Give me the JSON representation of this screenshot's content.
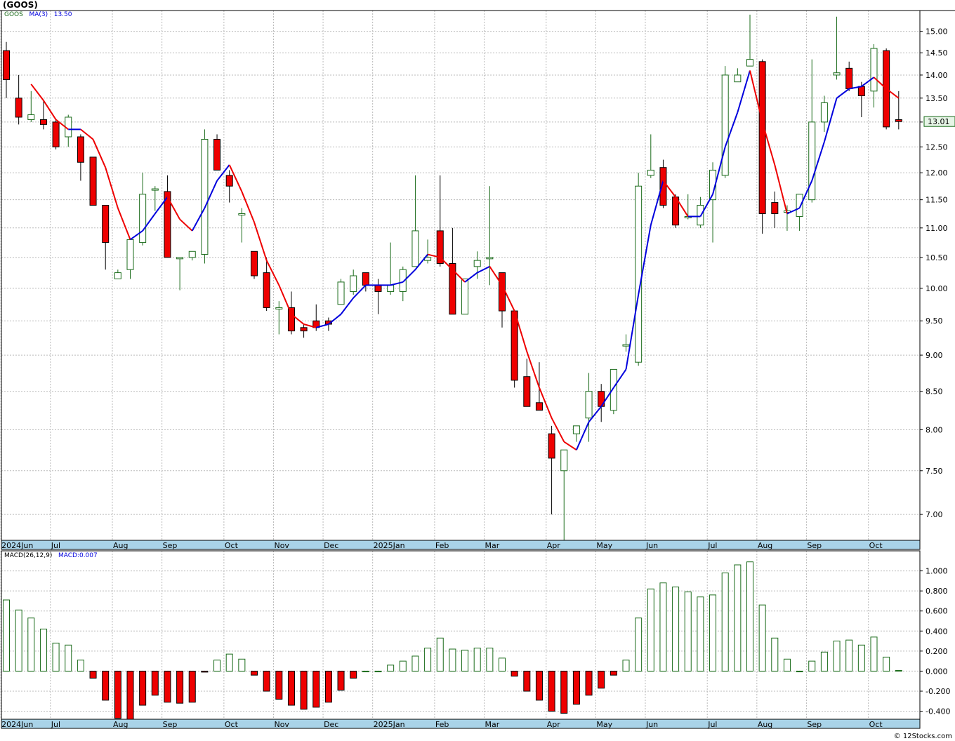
{
  "header": {
    "ticker": "(GOOS)"
  },
  "price_legend": {
    "symbol": "GOOS",
    "ma_label": "MA(3)",
    "ma_value": "13.50"
  },
  "macd_legend": {
    "label": "MACD(26,12,9)",
    "value_label": "MACD:0.007"
  },
  "last_price_tag": "13.01",
  "watermark": "© 12Stocks.com",
  "colors": {
    "up": "#1a6b1a",
    "down": "#ee0000",
    "ma_up": "#0000dd",
    "ma_down": "#ee0000",
    "grid": "#bbbbbb",
    "axis_band": "#a9d3e8"
  },
  "chart_data": [
    {
      "type": "candlestick",
      "title": "(GOOS)",
      "interval": "weekly",
      "y_scale": "log",
      "ylim": [
        6.72,
        15.5
      ],
      "y_ticks": [
        "7.00",
        "7.50",
        "8.00",
        "8.50",
        "9.00",
        "9.50",
        "10.00",
        "10.50",
        "11.00",
        "11.50",
        "12.00",
        "12.50",
        "13.00",
        "13.50",
        "14.00",
        "14.50",
        "15.00"
      ],
      "x_tick_labels": [
        {
          "label": "2024Jun",
          "week": 0
        },
        {
          "label": "Jul",
          "week": 4
        },
        {
          "label": "Aug",
          "week": 9
        },
        {
          "label": "Sep",
          "week": 13
        },
        {
          "label": "Oct",
          "week": 18
        },
        {
          "label": "Nov",
          "week": 22
        },
        {
          "label": "Dec",
          "week": 26
        },
        {
          "label": "2025Jan",
          "week": 30
        },
        {
          "label": "Feb",
          "week": 35
        },
        {
          "label": "Mar",
          "week": 39
        },
        {
          "label": "Apr",
          "week": 44
        },
        {
          "label": "May",
          "week": 48
        },
        {
          "label": "Jun",
          "week": 52
        },
        {
          "label": "Jul",
          "week": 57
        },
        {
          "label": "Aug",
          "week": 61
        },
        {
          "label": "Sep",
          "week": 65
        },
        {
          "label": "Oct",
          "week": 70
        }
      ],
      "grid": true,
      "ohlc": [
        [
          14.55,
          14.75,
          13.5,
          13.9
        ],
        [
          13.5,
          14.0,
          12.95,
          13.1
        ],
        [
          13.05,
          13.65,
          13.0,
          13.15
        ],
        [
          13.05,
          13.45,
          12.85,
          12.95
        ],
        [
          13.0,
          13.05,
          12.45,
          12.5
        ],
        [
          12.7,
          13.15,
          12.5,
          13.1
        ],
        [
          12.7,
          12.75,
          11.85,
          12.2
        ],
        [
          12.3,
          12.3,
          11.4,
          11.4
        ],
        [
          11.4,
          11.4,
          10.3,
          10.75
        ],
        [
          10.15,
          10.3,
          10.15,
          10.25
        ],
        [
          10.3,
          10.8,
          10.15,
          10.8
        ],
        [
          10.75,
          12.0,
          10.7,
          11.6
        ],
        [
          11.7,
          11.75,
          11.3,
          11.7
        ],
        [
          11.65,
          11.95,
          10.5,
          10.5
        ],
        [
          10.5,
          10.5,
          9.97,
          10.5
        ],
        [
          10.5,
          10.6,
          10.45,
          10.6
        ],
        [
          10.55,
          12.85,
          10.4,
          12.65
        ],
        [
          12.65,
          12.75,
          12.05,
          12.05
        ],
        [
          11.95,
          12.05,
          11.45,
          11.75
        ],
        [
          11.25,
          11.35,
          10.75,
          11.25
        ],
        [
          10.6,
          10.6,
          10.15,
          10.2
        ],
        [
          10.25,
          10.5,
          9.65,
          9.7
        ],
        [
          9.7,
          9.8,
          9.3,
          9.7
        ],
        [
          9.7,
          9.95,
          9.3,
          9.35
        ],
        [
          9.4,
          9.45,
          9.25,
          9.35
        ],
        [
          9.5,
          9.75,
          9.35,
          9.4
        ],
        [
          9.5,
          9.55,
          9.35,
          9.45
        ],
        [
          9.75,
          10.15,
          9.75,
          10.1
        ],
        [
          9.95,
          10.3,
          9.9,
          10.2
        ],
        [
          10.25,
          10.25,
          9.95,
          10.05
        ],
        [
          10.05,
          10.15,
          9.6,
          9.95
        ],
        [
          9.95,
          10.75,
          9.9,
          10.05
        ],
        [
          9.95,
          10.35,
          9.8,
          10.3
        ],
        [
          10.35,
          11.95,
          10.35,
          10.95
        ],
        [
          10.45,
          10.8,
          10.4,
          10.5
        ],
        [
          10.95,
          11.95,
          10.35,
          10.4
        ],
        [
          10.4,
          11.0,
          9.6,
          9.6
        ],
        [
          9.6,
          10.15,
          9.6,
          10.15
        ],
        [
          10.35,
          10.6,
          10.15,
          10.45
        ],
        [
          10.5,
          11.75,
          10.05,
          10.5
        ],
        [
          10.25,
          10.25,
          9.4,
          9.65
        ],
        [
          9.65,
          9.65,
          8.55,
          8.65
        ],
        [
          8.7,
          8.95,
          8.3,
          8.3
        ],
        [
          8.35,
          8.9,
          8.25,
          8.25
        ],
        [
          7.95,
          8.05,
          7.0,
          7.65
        ],
        [
          7.5,
          7.75,
          6.72,
          7.75
        ],
        [
          7.95,
          8.05,
          7.85,
          8.05
        ],
        [
          8.15,
          8.75,
          7.85,
          8.5
        ],
        [
          8.5,
          8.6,
          8.1,
          8.3
        ],
        [
          8.25,
          8.8,
          8.2,
          8.8
        ],
        [
          9.15,
          9.3,
          9.05,
          9.15
        ],
        [
          8.9,
          12.0,
          8.85,
          11.75
        ],
        [
          11.95,
          12.75,
          11.9,
          12.05
        ],
        [
          12.1,
          12.25,
          11.35,
          11.4
        ],
        [
          11.55,
          11.6,
          11.0,
          11.05
        ],
        [
          11.2,
          11.6,
          11.15,
          11.2
        ],
        [
          11.05,
          11.55,
          11.0,
          11.4
        ],
        [
          11.5,
          12.2,
          10.75,
          12.05
        ],
        [
          11.95,
          14.2,
          11.9,
          14.0
        ],
        [
          13.85,
          14.15,
          13.9,
          14.0
        ],
        [
          14.2,
          15.4,
          14.2,
          14.35
        ],
        [
          14.3,
          14.35,
          10.9,
          11.25
        ],
        [
          11.45,
          11.65,
          11.0,
          11.25
        ],
        [
          11.3,
          11.4,
          10.95,
          11.3
        ],
        [
          11.2,
          11.6,
          10.95,
          11.6
        ],
        [
          11.5,
          14.35,
          11.45,
          13.0
        ],
        [
          13.0,
          13.55,
          12.8,
          13.4
        ],
        [
          14.0,
          15.35,
          13.9,
          14.05
        ],
        [
          14.15,
          14.3,
          13.65,
          13.7
        ],
        [
          13.75,
          13.85,
          13.1,
          13.55
        ],
        [
          13.65,
          14.7,
          13.3,
          14.6
        ],
        [
          14.55,
          14.6,
          12.85,
          12.9
        ],
        [
          13.05,
          13.65,
          12.85,
          13.01
        ]
      ],
      "moving_average": {
        "name": "MA(3)",
        "values": [
          null,
          null,
          13.8,
          13.45,
          13.05,
          12.85,
          12.85,
          12.65,
          12.1,
          11.35,
          10.8,
          10.95,
          11.25,
          11.55,
          11.15,
          10.95,
          11.35,
          11.85,
          12.15,
          11.65,
          11.1,
          10.45,
          10.05,
          9.6,
          9.45,
          9.4,
          9.45,
          9.6,
          9.85,
          10.05,
          10.05,
          10.05,
          10.1,
          10.3,
          10.55,
          10.5,
          10.3,
          10.1,
          10.25,
          10.35,
          10.05,
          9.65,
          9.05,
          8.55,
          8.15,
          7.85,
          7.75,
          8.1,
          8.3,
          8.55,
          8.8,
          9.9,
          11.05,
          11.85,
          11.55,
          11.2,
          11.2,
          11.6,
          12.5,
          13.2,
          14.1,
          13.0,
          12.15,
          11.25,
          11.35,
          11.85,
          12.6,
          13.5,
          13.7,
          13.75,
          13.95,
          13.7,
          13.5
        ]
      }
    },
    {
      "type": "bar",
      "title": "MACD(26,12,9)",
      "ylim": [
        -0.48,
        1.2
      ],
      "y_ticks": [
        "-0.400",
        "-0.200",
        "0.000",
        "0.200",
        "0.400",
        "0.600",
        "0.800",
        "1.000"
      ],
      "values": [
        0.71,
        0.61,
        0.53,
        0.42,
        0.28,
        0.26,
        0.11,
        -0.07,
        -0.29,
        -0.47,
        -0.48,
        -0.34,
        -0.24,
        -0.31,
        -0.32,
        -0.31,
        -0.01,
        0.11,
        0.17,
        0.12,
        -0.04,
        -0.2,
        -0.28,
        -0.34,
        -0.38,
        -0.36,
        -0.31,
        -0.19,
        -0.07,
        0.0,
        0.0,
        0.06,
        0.1,
        0.15,
        0.23,
        0.33,
        0.22,
        0.21,
        0.23,
        0.23,
        0.13,
        -0.05,
        -0.2,
        -0.29,
        -0.4,
        -0.42,
        -0.33,
        -0.24,
        -0.17,
        -0.04,
        0.11,
        0.53,
        0.82,
        0.88,
        0.84,
        0.79,
        0.74,
        0.76,
        0.98,
        1.06,
        1.09,
        0.66,
        0.33,
        0.12,
        0.0,
        0.1,
        0.19,
        0.3,
        0.31,
        0.26,
        0.34,
        0.14,
        0.007
      ]
    }
  ]
}
